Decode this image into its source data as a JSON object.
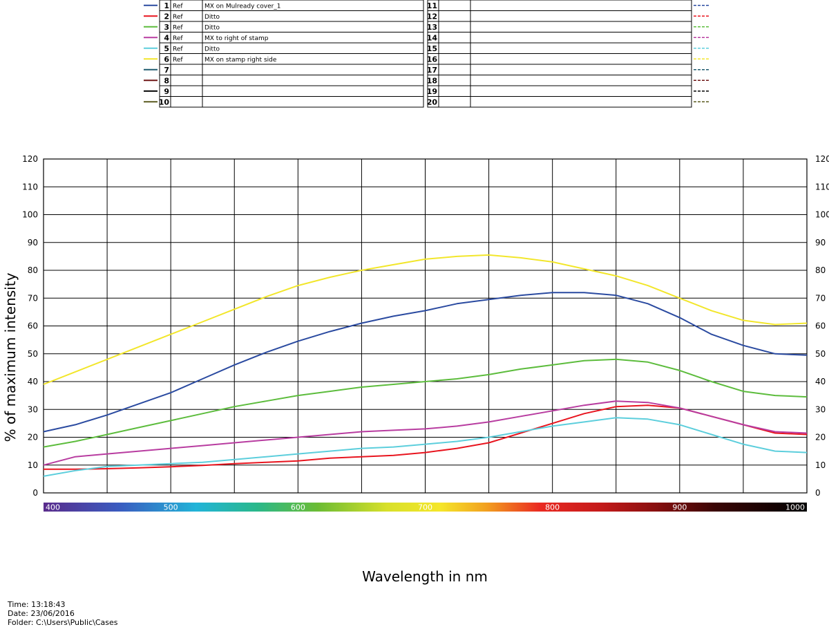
{
  "footer": {
    "time": "Time: 13:18:43",
    "date": "Date: 23/06/2016",
    "folder": "Folder: C:\\Users\\Public\\Cases"
  },
  "legend_table": {
    "rows_left": [
      {
        "num": "1",
        "ref": "Ref",
        "desc": "MX on Mulready cover_1",
        "color": "#2a4aa0"
      },
      {
        "num": "2",
        "ref": "Ref",
        "desc": "Ditto",
        "color": "#e8141e"
      },
      {
        "num": "3",
        "ref": "Ref",
        "desc": "Ditto",
        "color": "#5cbc3c"
      },
      {
        "num": "4",
        "ref": "Ref",
        "desc": "MX to right of stamp",
        "color": "#b83ca0"
      },
      {
        "num": "5",
        "ref": "Ref",
        "desc": "Ditto",
        "color": "#5ccedc"
      },
      {
        "num": "6",
        "ref": "Ref",
        "desc": "MX on stamp right side",
        "color": "#f2e62a"
      },
      {
        "num": "7",
        "ref": "",
        "desc": "",
        "color": "#1e5a6e"
      },
      {
        "num": "8",
        "ref": "",
        "desc": "",
        "color": "#6e1414"
      },
      {
        "num": "9",
        "ref": "",
        "desc": "",
        "color": "#000000"
      },
      {
        "num": "10",
        "ref": "",
        "desc": "",
        "color": "#5a5a1e"
      }
    ],
    "rows_right": [
      {
        "num": "11",
        "ref": "",
        "desc": "",
        "color": "#2a4aa0"
      },
      {
        "num": "12",
        "ref": "",
        "desc": "",
        "color": "#e8141e"
      },
      {
        "num": "13",
        "ref": "",
        "desc": "",
        "color": "#5cbc3c"
      },
      {
        "num": "14",
        "ref": "",
        "desc": "",
        "color": "#b83ca0"
      },
      {
        "num": "15",
        "ref": "",
        "desc": "",
        "color": "#5ccedc"
      },
      {
        "num": "16",
        "ref": "",
        "desc": "",
        "color": "#f2e62a"
      },
      {
        "num": "17",
        "ref": "",
        "desc": "",
        "color": "#1e5a6e"
      },
      {
        "num": "18",
        "ref": "",
        "desc": "",
        "color": "#6e1414"
      },
      {
        "num": "19",
        "ref": "",
        "desc": "",
        "color": "#000000"
      },
      {
        "num": "20",
        "ref": "",
        "desc": "",
        "color": "#5a5a1e"
      }
    ]
  },
  "chart_data": {
    "type": "line",
    "title": "",
    "xlabel": "Wavelength in nm",
    "ylabel": "% of maximum intensity",
    "xlim": [
      400,
      1000
    ],
    "ylim": [
      0,
      120
    ],
    "grid": true,
    "legend": "top table",
    "x_ticks": [
      400,
      500,
      600,
      700,
      800,
      900,
      1000
    ],
    "x_tick_labels": [
      "400",
      "500",
      "600",
      "700",
      "800",
      "900",
      "1000"
    ],
    "y_ticks": [
      0,
      10,
      20,
      30,
      40,
      50,
      60,
      70,
      80,
      90,
      100,
      110,
      120
    ],
    "y_tick_labels": [
      "0",
      "10",
      "20",
      "30",
      "40",
      "50",
      "60",
      "70",
      "80",
      "90",
      "100",
      "110",
      "120"
    ],
    "x": [
      400,
      425,
      450,
      475,
      500,
      525,
      550,
      575,
      600,
      625,
      650,
      675,
      700,
      725,
      750,
      775,
      800,
      825,
      850,
      875,
      900,
      925,
      950,
      975,
      1000
    ],
    "series": [
      {
        "name": "1",
        "color": "#2a4aa0",
        "values": [
          22,
          24.5,
          28,
          32,
          36,
          41,
          46,
          50.5,
          54.5,
          58,
          61,
          63.5,
          65.5,
          68,
          69.5,
          71,
          72,
          72,
          71,
          68,
          63,
          57,
          53,
          50,
          49.5
        ]
      },
      {
        "name": "2",
        "color": "#e8141e",
        "values": [
          8.5,
          8.5,
          8.7,
          9,
          9.4,
          9.9,
          10.5,
          11,
          11.5,
          12.5,
          13,
          13.5,
          14.5,
          16,
          18,
          21.5,
          25,
          28.5,
          31,
          31.5,
          30.5,
          27.5,
          24.5,
          21.5,
          21
        ]
      },
      {
        "name": "3",
        "color": "#5cbc3c",
        "values": [
          16.5,
          18.5,
          21,
          23.5,
          26,
          28.5,
          31,
          33,
          35,
          36.5,
          38,
          39,
          40,
          41,
          42.5,
          44.5,
          46,
          47.5,
          48,
          47,
          44,
          40,
          36.5,
          35,
          34.5
        ]
      },
      {
        "name": "4",
        "color": "#b83ca0",
        "values": [
          10,
          13,
          14,
          15,
          16,
          17,
          18,
          19,
          20,
          21,
          22,
          22.5,
          23,
          24,
          25.5,
          27.5,
          29.5,
          31.5,
          33,
          32.5,
          30.5,
          27.5,
          24.5,
          22,
          21.5
        ]
      },
      {
        "name": "5",
        "color": "#5ccedc",
        "values": [
          6,
          8,
          9.5,
          10,
          10.5,
          11,
          12,
          13,
          14,
          15,
          16,
          16.5,
          17.5,
          18.5,
          20,
          22,
          24,
          25.5,
          27,
          26.5,
          24.5,
          21,
          17.5,
          15,
          14.5
        ]
      },
      {
        "name": "6",
        "color": "#f2e62a",
        "values": [
          39,
          43.5,
          48,
          52.5,
          57,
          61.5,
          66,
          70.5,
          74.5,
          77.5,
          80,
          82,
          84,
          85,
          85.5,
          84.5,
          83,
          80.5,
          78,
          74.5,
          70,
          65.5,
          62,
          60.5,
          61
        ]
      }
    ]
  }
}
